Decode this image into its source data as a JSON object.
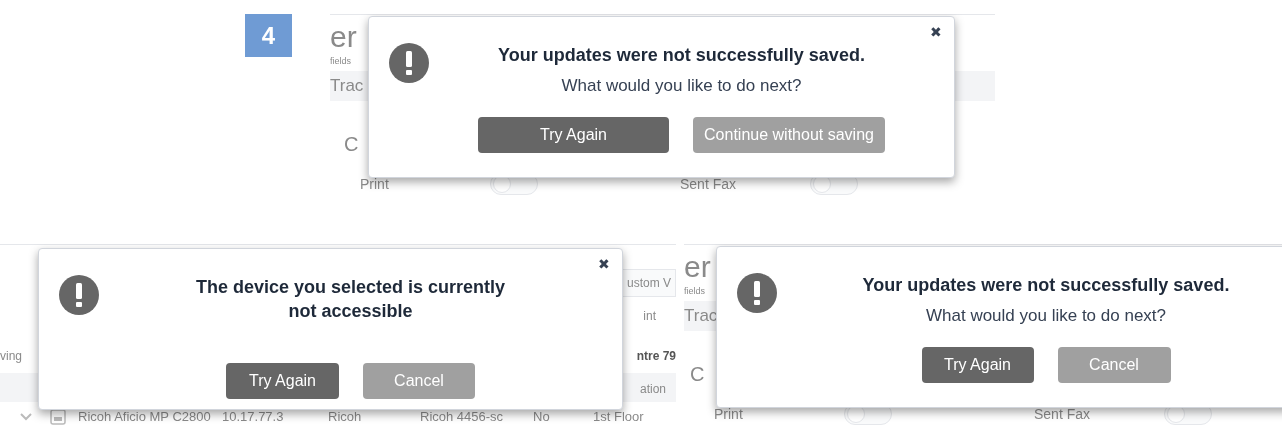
{
  "badge": "4",
  "panels": [
    {
      "kind": "form",
      "background": {
        "heading": "er",
        "subheading": "fields",
        "tab": "Trac",
        "label": "C",
        "toggles": [
          {
            "label": "Print",
            "on": false
          },
          {
            "label": "Sent Fax",
            "on": false
          }
        ]
      },
      "dialog": {
        "close": "✖",
        "title": "Your updates were not successfully saved.",
        "subtitle": "What would you like to do next?",
        "buttons": [
          {
            "label": "Try Again",
            "kind": "primary"
          },
          {
            "label": "Continue without saving",
            "kind": "secondary"
          }
        ]
      }
    },
    {
      "kind": "table",
      "background": {
        "header_fragment": "ustom V",
        "column_fragment": "int",
        "left_fragment": "ving",
        "right_fragment": "ntre 79",
        "header_cell": "ation",
        "row": [
          "Ricoh Aficio MP C2800",
          "10.17.77.3",
          "Ricoh",
          "Ricoh 4456-sc",
          "No",
          "1st Floor"
        ]
      },
      "dialog": {
        "close": "✖",
        "title": "The device you selected is currently not accessible",
        "buttons": [
          {
            "label": "Try Again",
            "kind": "primary"
          },
          {
            "label": "Cancel",
            "kind": "secondary"
          }
        ]
      }
    },
    {
      "kind": "form",
      "background": {
        "heading": "er",
        "subheading": "fields",
        "tab": "Trac",
        "label": "C",
        "toggles": [
          {
            "label": "Print",
            "on": false
          },
          {
            "label": "Sent Fax",
            "on": false
          }
        ]
      },
      "dialog": {
        "title": "Your updates were not successfully saved.",
        "subtitle": "What would you like to do next?",
        "buttons": [
          {
            "label": "Try Again",
            "kind": "primary"
          },
          {
            "label": "Cancel",
            "kind": "secondary"
          }
        ]
      }
    }
  ]
}
